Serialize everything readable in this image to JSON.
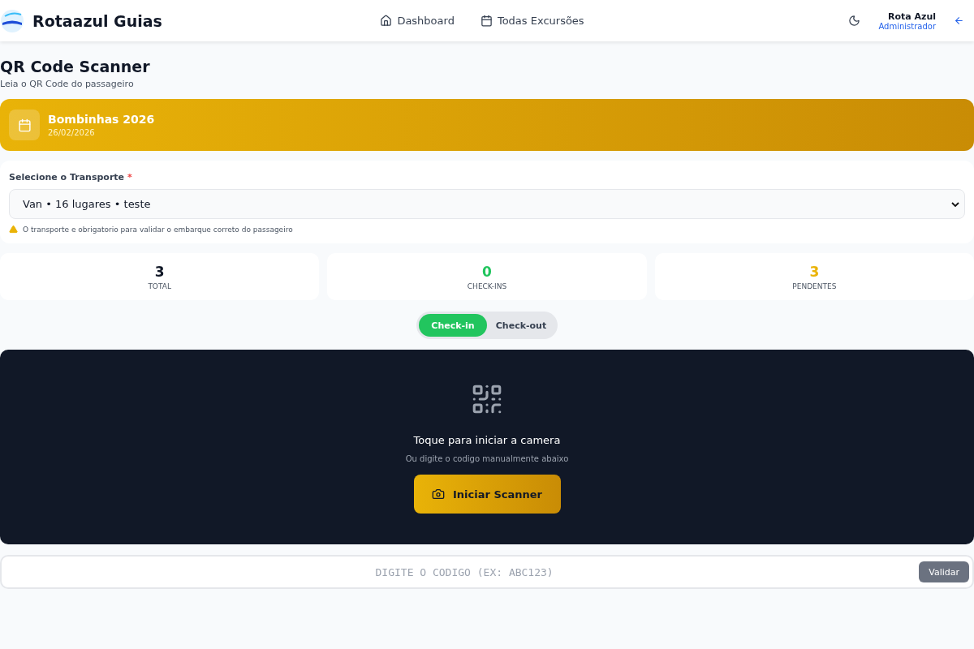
{
  "header": {
    "brand": "Rotaazul Guias",
    "nav": [
      {
        "label": "Dashboard"
      },
      {
        "label": "Todas Excursões"
      }
    ],
    "user": {
      "name": "Rota Azul",
      "role": "Administrador"
    }
  },
  "page": {
    "title": "QR Code Scanner",
    "subtitle": "Leia o QR Code do passageiro"
  },
  "trip": {
    "name": "Bombinhas 2026",
    "date": "26/02/2026"
  },
  "transport": {
    "label": "Selecione o Transporte",
    "required_mark": "*",
    "value": "Van • 16 lugares • teste",
    "warning": "O transporte e obrigatorio para validar o embarque correto do passageiro"
  },
  "stats": [
    {
      "value": "3",
      "label": "TOTAL",
      "color": "#111827"
    },
    {
      "value": "0",
      "label": "CHECK-INS",
      "color": "#22c55e"
    },
    {
      "value": "3",
      "label": "PENDENTES",
      "color": "#eab308"
    }
  ],
  "modes": [
    {
      "label": "Check-in",
      "selected": true
    },
    {
      "label": "Check-out",
      "selected": false
    }
  ],
  "scanner": {
    "title": "Toque para iniciar a camera",
    "hint": "Ou digite o codigo manualmente abaixo",
    "button": "Iniciar Scanner"
  },
  "manual": {
    "placeholder": "DIGITE O CODIGO (EX: ABC123)",
    "button": "Validar"
  }
}
